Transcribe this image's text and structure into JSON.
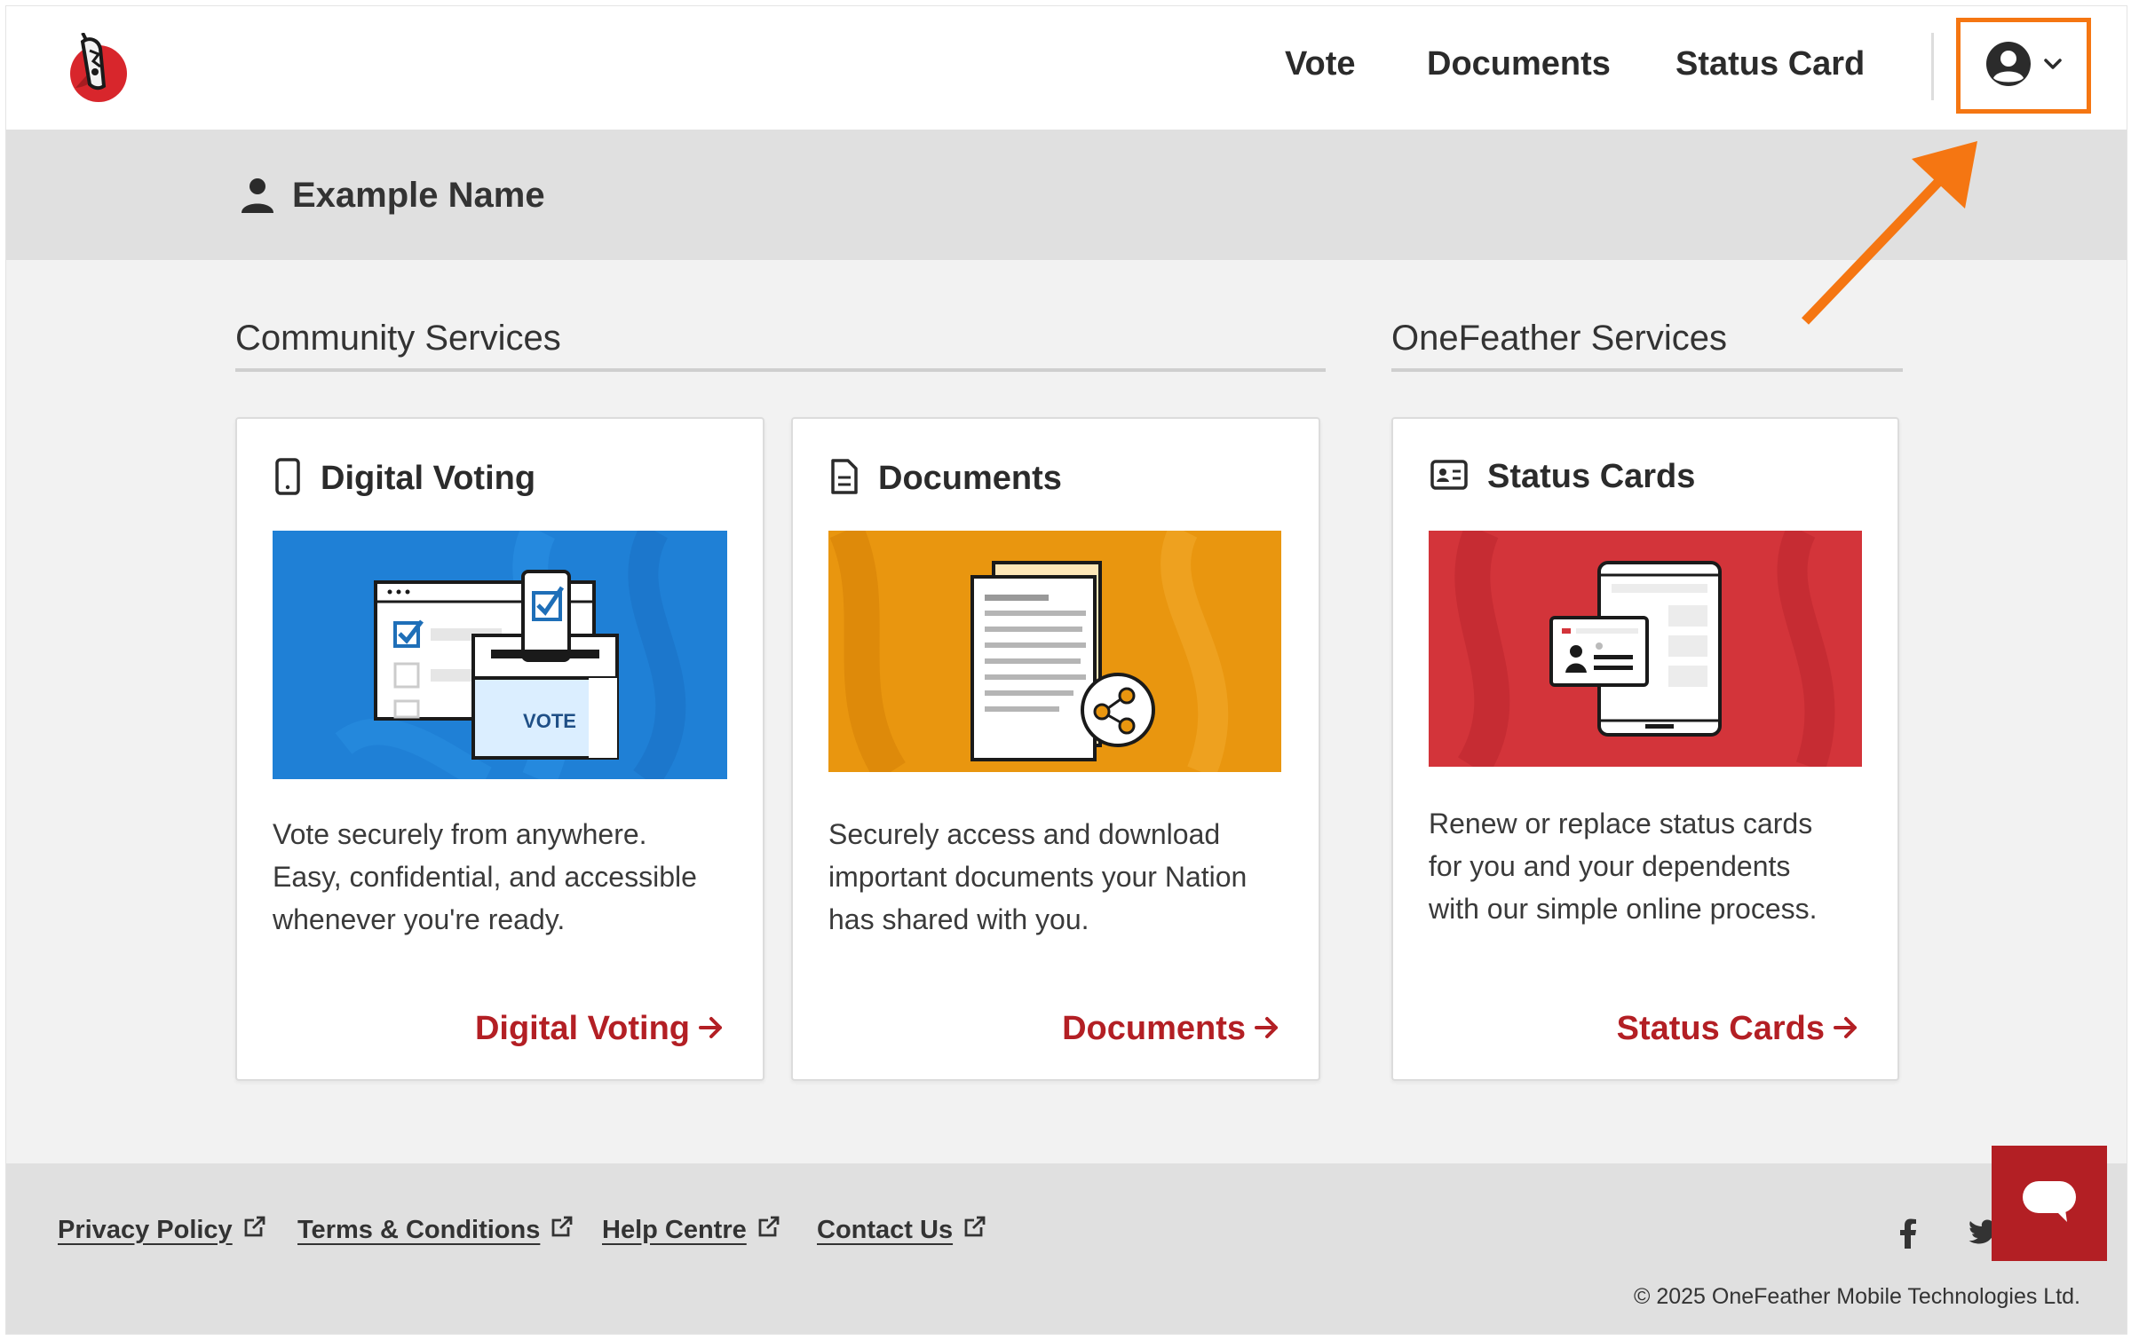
{
  "header": {
    "logo_icon": "onefeather-logo",
    "nav": {
      "vote": "Vote",
      "documents": "Documents",
      "status_card": "Status Card"
    },
    "account_icon": "user-circle-icon",
    "account_chevron_icon": "chevron-down-icon",
    "highlight_color": "#f57612"
  },
  "user": {
    "name": "Example Name",
    "icon": "person-icon"
  },
  "sections": {
    "community": {
      "title": "Community Services"
    },
    "onefeather": {
      "title": "OneFeather Services"
    }
  },
  "cards": [
    {
      "icon": "mobile-phone-icon",
      "title": "Digital Voting",
      "image": "ballot-box-illustration",
      "image_text": "VOTE",
      "image_color": "#1f80d6",
      "desc_lines": [
        "Vote securely from anywhere.",
        "Easy, confidential, and accessible",
        "whenever you're ready."
      ],
      "link": "Digital Voting"
    },
    {
      "icon": "document-icon",
      "title": "Documents",
      "image": "shared-documents-illustration",
      "image_color": "#e9960f",
      "desc_lines": [
        "Securely access and download",
        "important documents your Nation",
        "has shared with you."
      ],
      "link": "Documents"
    },
    {
      "icon": "id-card-icon",
      "title": "Status Cards",
      "image": "status-card-tablet-illustration",
      "image_color": "#d3343a",
      "desc_lines": [
        "Renew or replace status cards",
        "for you and your dependents",
        "with our simple online process."
      ],
      "link": "Status Cards"
    }
  ],
  "link_color": "#b31f24",
  "footer": {
    "links": [
      "Privacy Policy",
      "Terms & Conditions",
      "Help Centre",
      "Contact Us"
    ],
    "external_icon": "external-link-icon",
    "social": [
      "facebook-icon",
      "twitter-icon"
    ],
    "copyright": "© 2025 OneFeather Mobile Technologies Ltd."
  },
  "chat_icon": "chat-bubble-icon"
}
